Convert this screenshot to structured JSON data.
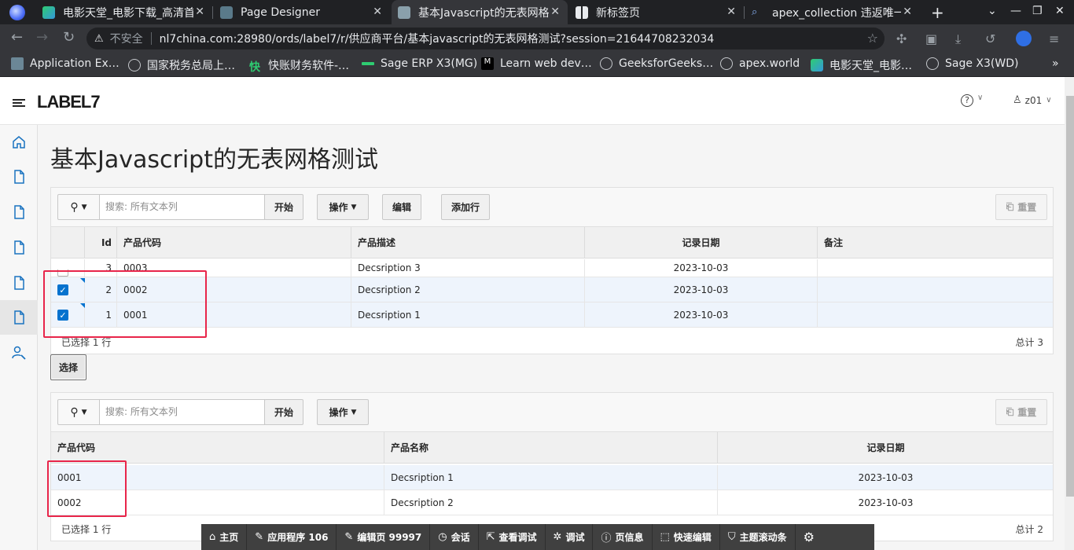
{
  "browser": {
    "tabs": [
      {
        "label": "电影天堂_电影下载_高清首",
        "active": false
      },
      {
        "label": "Page Designer",
        "active": false
      },
      {
        "label": "基本Javascript的无表网格",
        "active": true
      },
      {
        "label": "新标签页",
        "active": false
      },
      {
        "label": "apex_collection 违返唯一",
        "active": false
      }
    ],
    "insecure_label": "不安全",
    "url": "nl7china.com:28980/ords/label7/r/供应商平台/基本javascript的无表网格测试?session=21644708232034",
    "bookmarks": [
      "Application Ex…",
      "国家税务总局上…",
      "快账财务软件-…",
      "Sage ERP X3(MG)",
      "Learn web dev…",
      "GeeksforGeeks…",
      "apex.world",
      "电影天堂_电影…",
      "Sage X3(WD)"
    ]
  },
  "app": {
    "logo": "LABEL7",
    "user": "z01",
    "page_title": "基本Javascript的无表网格测试"
  },
  "grid1": {
    "search_placeholder": "搜索: 所有文本列",
    "go_label": "开始",
    "actions_label": "操作",
    "edit_label": "编辑",
    "add_row_label": "添加行",
    "reset_label": "重置",
    "columns": [
      "Id",
      "产品代码",
      "产品描述",
      "记录日期",
      "备注"
    ],
    "rows": [
      {
        "id": "3",
        "code": "0003",
        "desc": "Decsription 3",
        "date": "2023-10-03",
        "note": "",
        "checked": false
      },
      {
        "id": "2",
        "code": "0002",
        "desc": "Decsription 2",
        "date": "2023-10-03",
        "note": "",
        "checked": true
      },
      {
        "id": "1",
        "code": "0001",
        "desc": "Decsription 1",
        "date": "2023-10-03",
        "note": "",
        "checked": true
      }
    ],
    "selected_text": "已选择 1 行",
    "total_text": "总计 3"
  },
  "select_button": "选择",
  "grid2": {
    "search_placeholder": "搜索: 所有文本列",
    "go_label": "开始",
    "actions_label": "操作",
    "reset_label": "重置",
    "columns": [
      "产品代码",
      "产品名称",
      "记录日期"
    ],
    "rows": [
      {
        "code": "0001",
        "name": "Decsription 1",
        "date": "2023-10-03"
      },
      {
        "code": "0002",
        "name": "Decsription 2",
        "date": "2023-10-03"
      }
    ],
    "selected_text": "已选择 1 行",
    "total_text": "总计 2"
  },
  "devbar": {
    "items": [
      "主页",
      "应用程序 106",
      "编辑页 99997",
      "会话",
      "查看调试",
      "调试",
      "页信息",
      "快速编辑",
      "主题滚动条"
    ]
  }
}
